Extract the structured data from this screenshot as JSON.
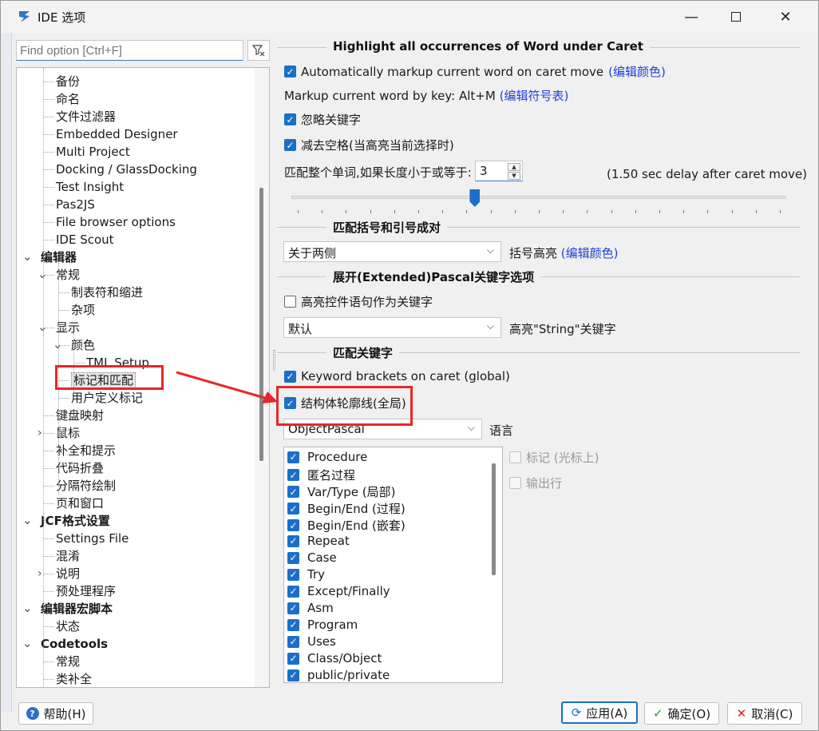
{
  "window": {
    "title": "IDE 选项"
  },
  "search": {
    "placeholder": "Find option [Ctrl+F]"
  },
  "tree": [
    {
      "label": "备份",
      "level": 1
    },
    {
      "label": "命名",
      "level": 1
    },
    {
      "label": "文件过滤器",
      "level": 1
    },
    {
      "label": "Embedded Designer",
      "level": 1
    },
    {
      "label": "Multi Project",
      "level": 1
    },
    {
      "label": "Docking / GlassDocking",
      "level": 1
    },
    {
      "label": "Test Insight",
      "level": 1
    },
    {
      "label": "Pas2JS",
      "level": 1
    },
    {
      "label": "File browser options",
      "level": 1
    },
    {
      "label": "IDE Scout",
      "level": 1
    },
    {
      "label": "编辑器",
      "level": 0,
      "bold": true,
      "expanded": true
    },
    {
      "label": "常规",
      "level": 1,
      "expanded": true
    },
    {
      "label": "制表符和缩进",
      "level": 2
    },
    {
      "label": "杂项",
      "level": 2
    },
    {
      "label": "显示",
      "level": 1,
      "expanded": true
    },
    {
      "label": "颜色",
      "level": 2,
      "expanded": true
    },
    {
      "label": "TML Setup",
      "level": 3
    },
    {
      "label": "标记和匹配",
      "level": 2,
      "selected": true
    },
    {
      "label": "用户定义标记",
      "level": 2
    },
    {
      "label": "键盘映射",
      "level": 1
    },
    {
      "label": "鼠标",
      "level": 1,
      "collapsed": true
    },
    {
      "label": "补全和提示",
      "level": 1
    },
    {
      "label": "代码折叠",
      "level": 1
    },
    {
      "label": "分隔符绘制",
      "level": 1
    },
    {
      "label": "页和窗口",
      "level": 1
    },
    {
      "label": "JCF格式设置",
      "level": 0,
      "bold": true,
      "expanded": true
    },
    {
      "label": "Settings File",
      "level": 1
    },
    {
      "label": "混淆",
      "level": 1
    },
    {
      "label": "说明",
      "level": 1,
      "collapsed": true
    },
    {
      "label": "预处理程序",
      "level": 1
    },
    {
      "label": "编辑器宏脚本",
      "level": 0,
      "bold": true,
      "expanded": true
    },
    {
      "label": "状态",
      "level": 1
    },
    {
      "label": "Codetools",
      "level": 0,
      "bold": true,
      "expanded": true
    },
    {
      "label": "常规",
      "level": 1
    },
    {
      "label": "类补全",
      "level": 1
    }
  ],
  "highlight": {
    "title": "Highlight all occurrences of Word under Caret",
    "auto_markup_label": "Automatically markup current word on caret move",
    "auto_markup_checked": true,
    "edit_color_link": "(编辑颜色)",
    "markup_by_key_label": "Markup current word by key: Alt+M",
    "edit_keymap_link": "(编辑符号表)",
    "ignore_keywords_label": "忽略关键字",
    "ignore_keywords_checked": true,
    "trim_spaces_label": "减去空格(当高亮当前选择时)",
    "trim_spaces_checked": true,
    "whole_word_label": "匹配整个单词,如果长度小于或等于:",
    "whole_word_value": "3",
    "delay_label": "(1.50 sec delay after caret move)",
    "delay_fraction": 0.37
  },
  "brackets": {
    "title": "匹配括号和引号成对",
    "mode_value": "关于两侧",
    "highlight_label": "括号高亮",
    "edit_color_link": "(编辑颜色)"
  },
  "extended": {
    "title": "展开(Extended)Pascal关键字选项",
    "ctrl_stmt_label": "高亮控件语句作为关键字",
    "ctrl_stmt_checked": false,
    "string_mode_value": "默认",
    "string_label": "高亮\"String\"关键字"
  },
  "keywords": {
    "title": "匹配关键字",
    "keyword_brackets_label": "Keyword brackets on caret (global)",
    "keyword_brackets_checked": true,
    "outline_label": "结构体轮廓线(全局)",
    "outline_checked": true,
    "language_value": "ObjectPascal",
    "language_label": "语言",
    "mark_label": "标记  (光标上)",
    "output_line_label": "输出行",
    "items": [
      "Procedure",
      "匿名过程",
      "Var/Type (局部)",
      "Begin/End (过程)",
      "Begin/End (嵌套)",
      "Repeat",
      "Case",
      "Try",
      "Except/Finally",
      "Asm",
      "Program",
      "Uses",
      "Class/Object",
      "public/private"
    ]
  },
  "footer": {
    "help_label": "帮助(H)",
    "apply_label": "应用(A)",
    "ok_label": "确定(O)",
    "cancel_label": "取消(C)"
  },
  "colors": {
    "accent": "#1b6fc9",
    "link": "#1f3fd6",
    "annotation": "#e8262a"
  }
}
